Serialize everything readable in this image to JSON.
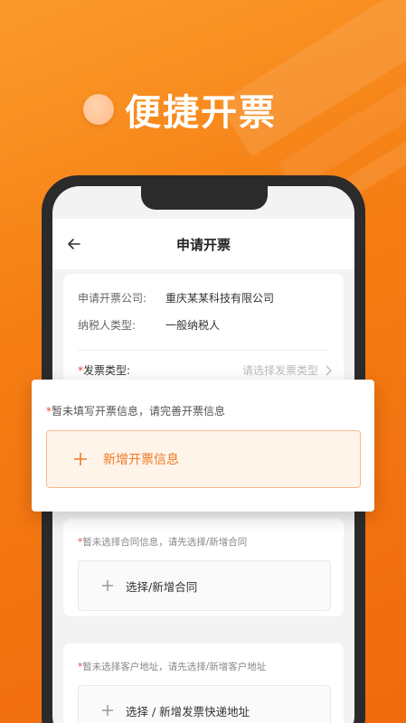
{
  "hero": {
    "title": "便捷开票"
  },
  "nav": {
    "title": "申请开票",
    "back_icon": "arrow-left-icon"
  },
  "company_info": {
    "company_label": "申请开票公司:",
    "company_value": "重庆某某科技有限公司",
    "taxpayer_label": "纳税人类型:",
    "taxpayer_value": "一般纳税人"
  },
  "invoice_type": {
    "required_mark": "*",
    "label": "发票类型:",
    "placeholder": "请选择发票类型"
  },
  "invoice_info": {
    "required_mark": "*",
    "note": "暂未填写开票信息，请完善开票信息",
    "add_label": "新增开票信息"
  },
  "contract": {
    "required_mark": "*",
    "note": "暂未选择合同信息，请先选择/新增合同",
    "add_label": "选择/新增合同"
  },
  "address": {
    "required_mark": "*",
    "note": "暂未选择客户地址，请先选择/新增客户地址",
    "add_label": "选择 / 新增发票快递地址"
  },
  "colors": {
    "brand_orange": "#f57d13",
    "accent_text": "#ef7a25",
    "required_red": "#e84a3a"
  }
}
